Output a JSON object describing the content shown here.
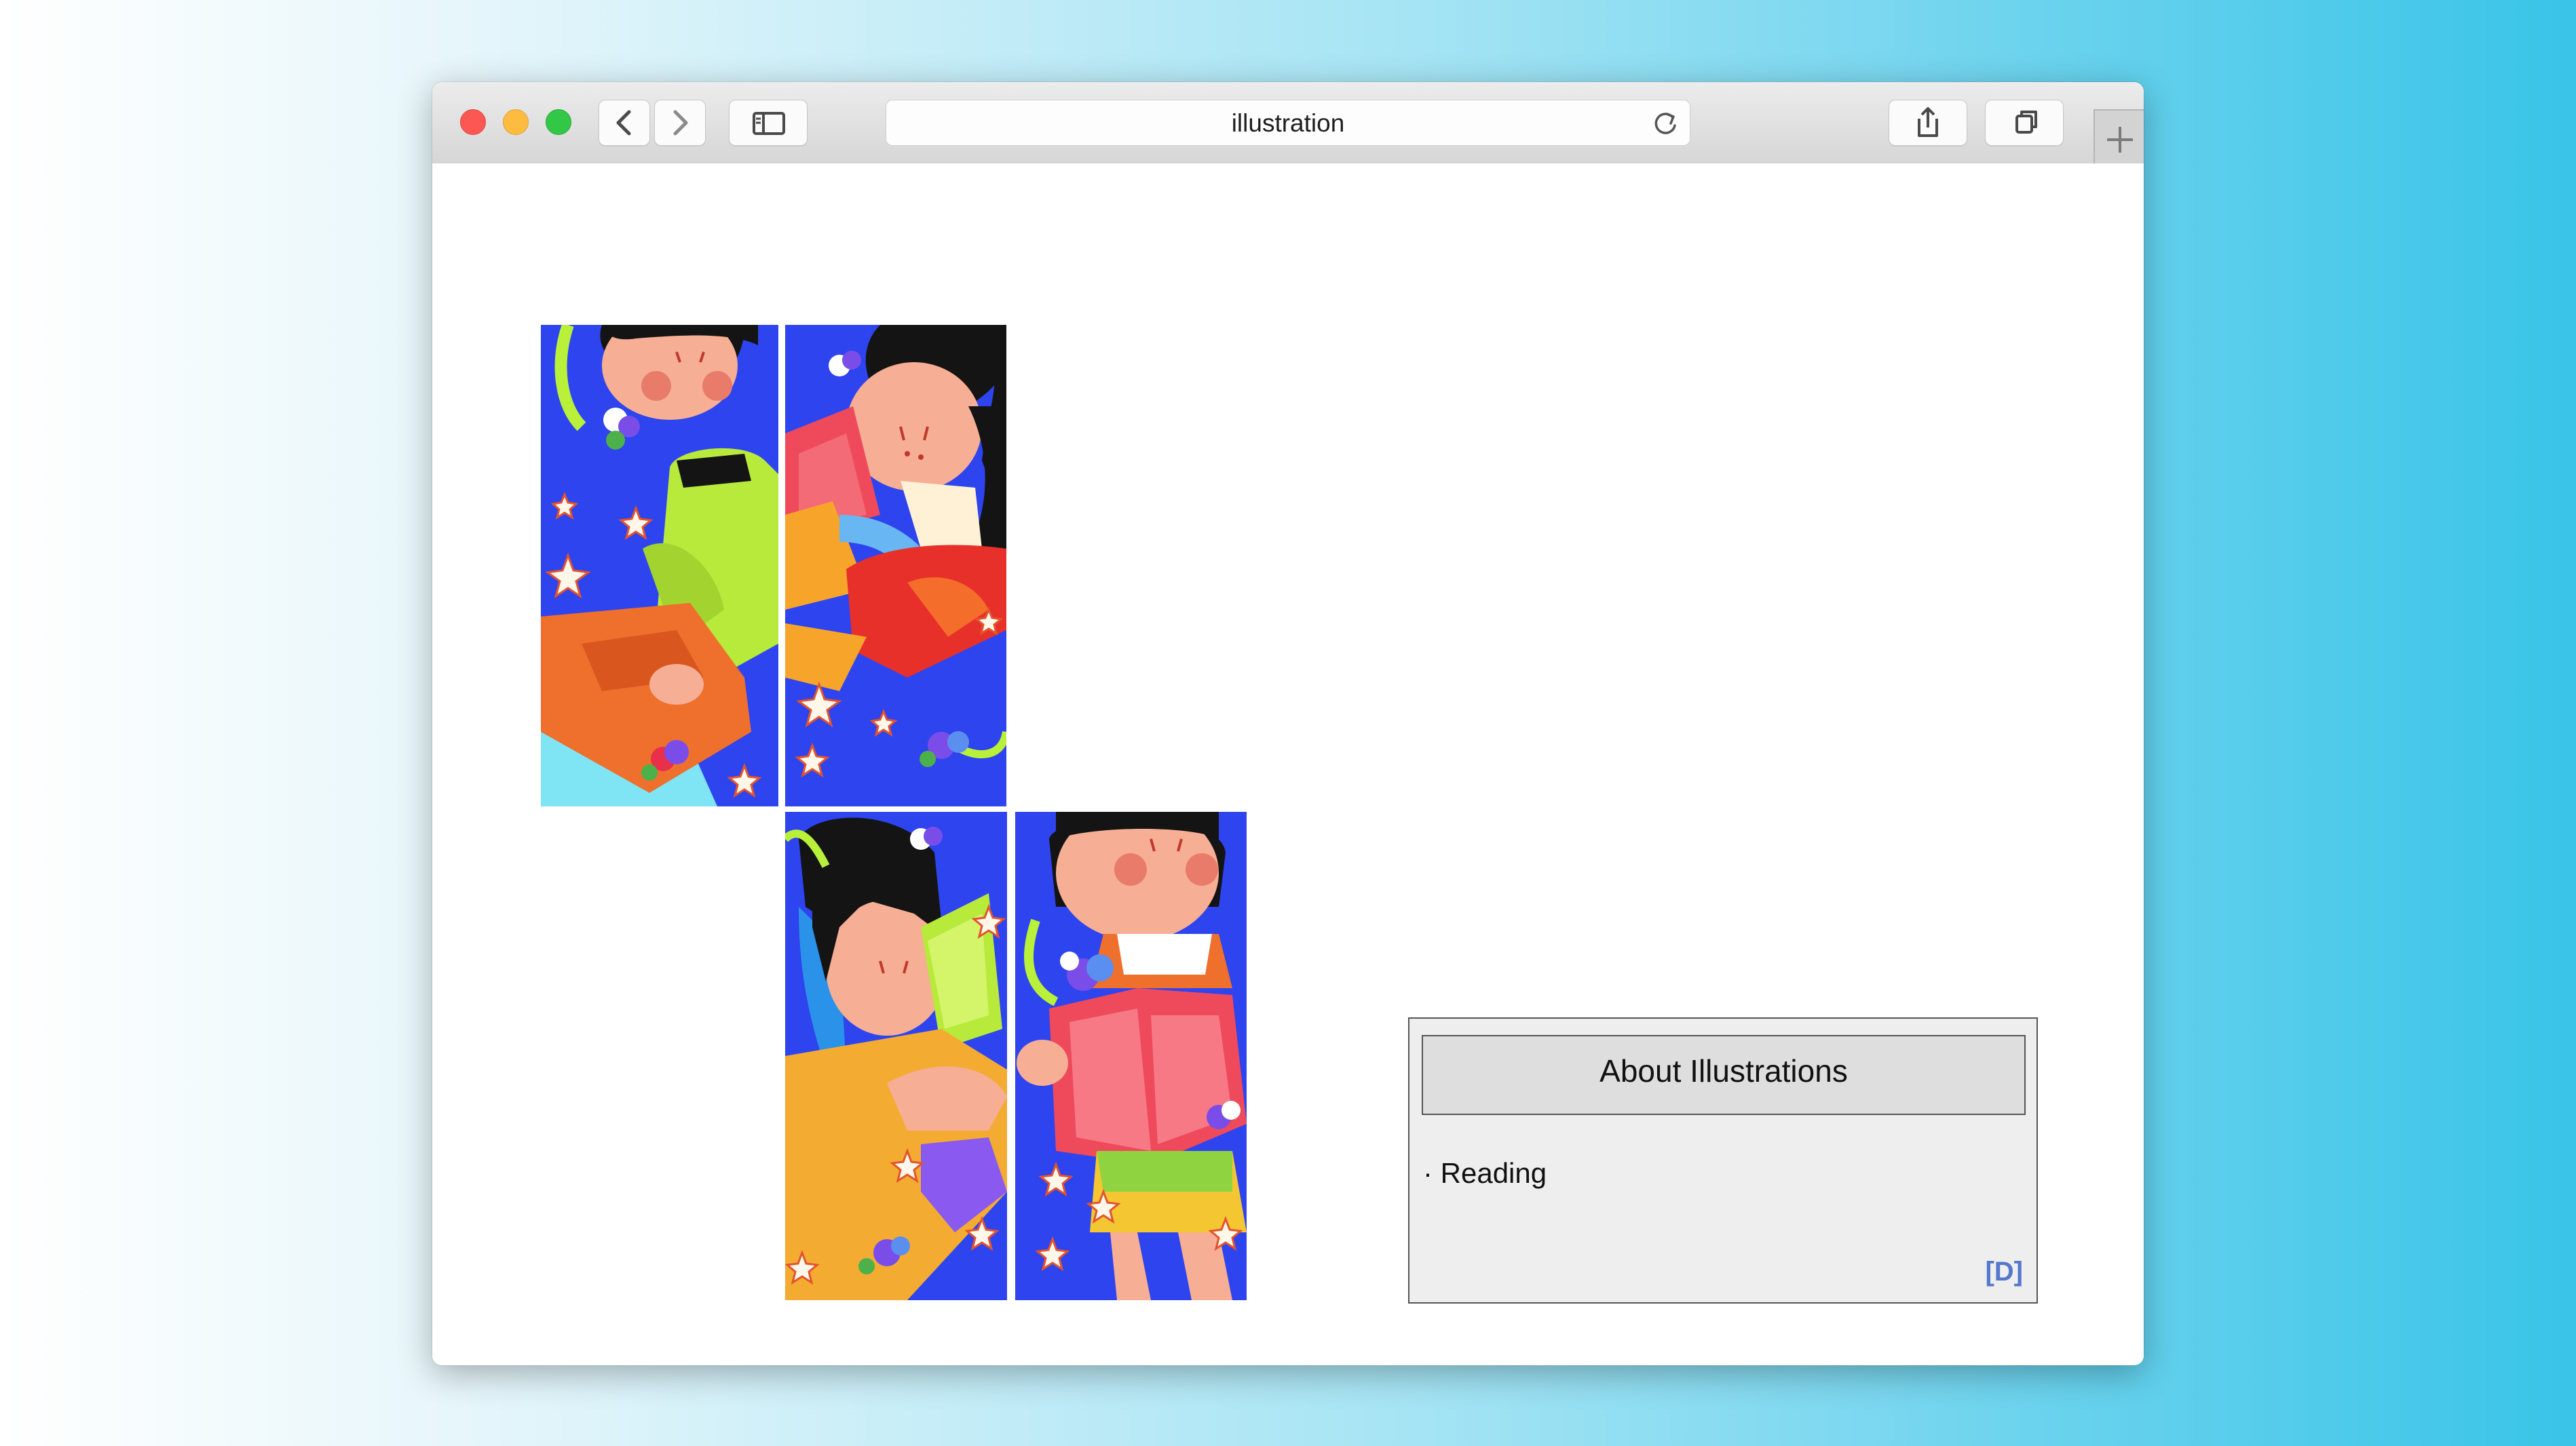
{
  "browser": {
    "url_text": "illustration",
    "buttons": [
      "back",
      "forward",
      "sidebar",
      "reload",
      "share",
      "tabs",
      "new-tab"
    ]
  },
  "gallery": {
    "panels": [
      {
        "name": "reading-panel-1",
        "subject": "girl in green sweater holding orange book"
      },
      {
        "name": "reading-panel-2",
        "subject": "girl with black hair reading red book"
      },
      {
        "name": "reading-panel-3",
        "subject": "girl in yellow shirt reading green book"
      },
      {
        "name": "reading-panel-4",
        "subject": "girl holding open pink book"
      }
    ]
  },
  "about": {
    "title": "About Illustrations",
    "item": "· Reading",
    "link": "[D]"
  },
  "colors": {
    "background_blue": "#2e44ee",
    "accent_link": "#5577cc"
  }
}
